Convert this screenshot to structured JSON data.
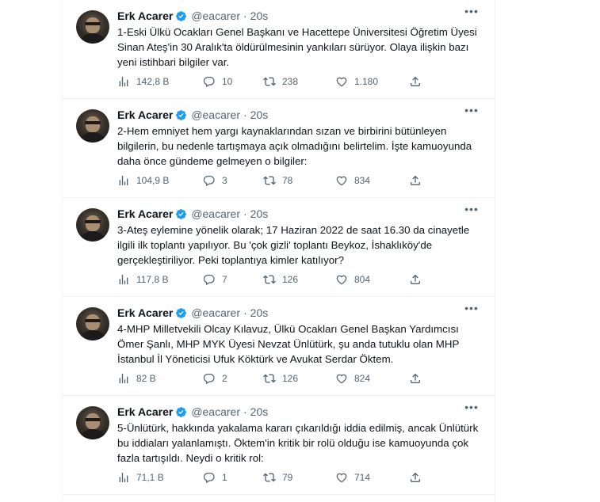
{
  "tweets": [
    {
      "name": "Erk Acarer",
      "handle": "@eacarer",
      "time": "20s",
      "text": "1-Eski Ülkü Ocakları Genel Başkanı ve Hacettepe Üniversitesi Öğretim Üyesi Sinan Ateş'in 30 Aralık'ta öldürülmesinin yankıları sürüyor. Olaya ilişkin bazı yeni istihbari bilgiler var.",
      "views": "142,8 B",
      "replies": "10",
      "retweets": "238",
      "likes": "1.180"
    },
    {
      "name": "Erk Acarer",
      "handle": "@eacarer",
      "time": "20s",
      "text": "2-Hem emniyet hem yargı kaynaklarından sızan ve birbirini bütünleyen bilgilerin, bu nedenle tartışmaya açık olmadığını belirtelim. İşte kamuoyunda daha önce gündeme gelmeyen o bilgiler:",
      "views": "104,9 B",
      "replies": "3",
      "retweets": "78",
      "likes": "834"
    },
    {
      "name": "Erk Acarer",
      "handle": "@eacarer",
      "time": "20s",
      "text": "3-Ateş eylemine yönelik olarak; 17 Haziran 2022 de saat 16.30 da cinayetle ilgili ilk toplantı yapılıyor. Bu 'çok gizli' toplantı Beykoz, İshaklıköy'de gerçekleştiriliyor. Peki toplantıya kimler katılıyor?",
      "views": "117,8 B",
      "replies": "7",
      "retweets": "126",
      "likes": "804"
    },
    {
      "name": "Erk Acarer",
      "handle": "@eacarer",
      "time": "20s",
      "text": "4-MHP Milletvekili Olcay Kılavuz, Ülkü Ocakları Genel Başkan Yardımcısı Ömer Şanlı, MHP MYK Üyesi Nevzat Ünlütürk, şu anda tutuklu olan MHP İstanbul İl Yöneticisi Ufuk Köktürk ve Avukat Serdar Öktem.",
      "views": "82 B",
      "replies": "2",
      "retweets": "126",
      "likes": "824"
    },
    {
      "name": "Erk Acarer",
      "handle": "@eacarer",
      "time": "20s",
      "text": "5-Ünlütürk, hakkında yakalama kararı çıkarıldığı iddia edilmiş, ancak Ünlütürk bu iddiaları yalanlamıştı. Öktem'in kritik bir rolü olduğu ise kamuoyunda çok fazla tartışıldı. Neydi o kritik rol:",
      "views": "71,1 B",
      "replies": "1",
      "retweets": "79",
      "likes": "714"
    }
  ],
  "icons": {
    "verified": "verified-badge-icon",
    "more": "more-icon",
    "views": "views-chart-icon",
    "reply": "reply-icon",
    "retweet": "retweet-icon",
    "like": "heart-icon",
    "share": "share-icon"
  },
  "colors": {
    "verified": "#1d9bf0",
    "text": "#0f1419",
    "muted": "#536471",
    "border": "#eff3f4"
  }
}
